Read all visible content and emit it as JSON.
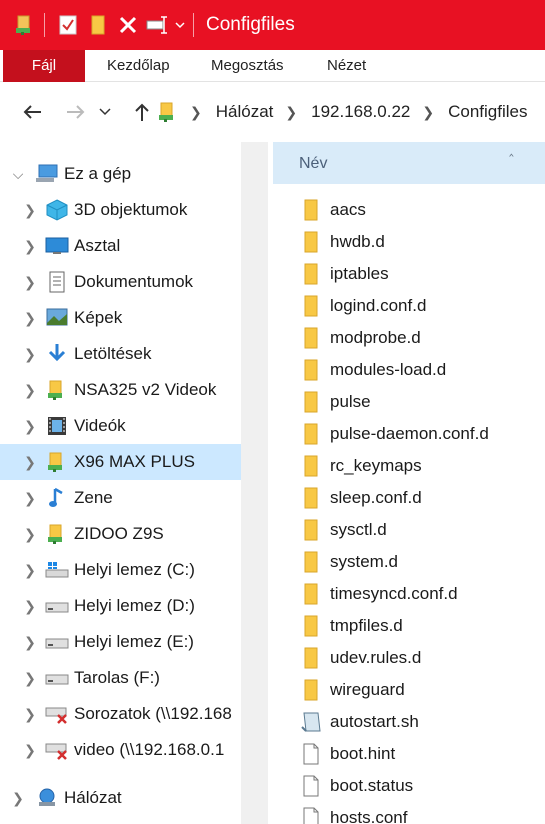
{
  "window": {
    "title": "Configfiles"
  },
  "ribbon": {
    "tabs": [
      "Fájl",
      "Kezdőlap",
      "Megosztás",
      "Nézet"
    ]
  },
  "address": {
    "crumbs": [
      "Hálózat",
      "192.168.0.22",
      "Configfiles"
    ]
  },
  "nav": {
    "this_pc": "Ez a gép",
    "items": [
      {
        "label": "3D objektumok",
        "icon": "3d-objects-icon"
      },
      {
        "label": "Asztal",
        "icon": "desktop-icon"
      },
      {
        "label": "Dokumentumok",
        "icon": "documents-icon"
      },
      {
        "label": "Képek",
        "icon": "pictures-icon"
      },
      {
        "label": "Letöltések",
        "icon": "downloads-icon"
      },
      {
        "label": "NSA325 v2 Videok",
        "icon": "network-folder-icon"
      },
      {
        "label": "Videók",
        "icon": "videos-icon"
      },
      {
        "label": "X96 MAX PLUS",
        "icon": "network-folder-icon"
      },
      {
        "label": "Zene",
        "icon": "music-icon"
      },
      {
        "label": "ZIDOO Z9S",
        "icon": "network-folder-icon"
      },
      {
        "label": "Helyi lemez (C:)",
        "icon": "windows-drive-icon"
      },
      {
        "label": "Helyi lemez (D:)",
        "icon": "drive-icon"
      },
      {
        "label": "Helyi lemez (E:)",
        "icon": "drive-icon"
      },
      {
        "label": "Tarolas (F:)",
        "icon": "drive-icon"
      },
      {
        "label": "Sorozatok (\\\\192.168",
        "icon": "disconnected-drive-icon"
      },
      {
        "label": "video (\\\\192.168.0.1",
        "icon": "disconnected-drive-icon"
      }
    ],
    "network": "Hálózat",
    "selected": "X96 MAX PLUS"
  },
  "list": {
    "column_name": "Név",
    "files": [
      {
        "name": "aacs",
        "type": "folder"
      },
      {
        "name": "hwdb.d",
        "type": "folder"
      },
      {
        "name": "iptables",
        "type": "folder"
      },
      {
        "name": "logind.conf.d",
        "type": "folder"
      },
      {
        "name": "modprobe.d",
        "type": "folder"
      },
      {
        "name": "modules-load.d",
        "type": "folder"
      },
      {
        "name": "pulse",
        "type": "folder"
      },
      {
        "name": "pulse-daemon.conf.d",
        "type": "folder"
      },
      {
        "name": "rc_keymaps",
        "type": "folder"
      },
      {
        "name": "sleep.conf.d",
        "type": "folder"
      },
      {
        "name": "sysctl.d",
        "type": "folder"
      },
      {
        "name": "system.d",
        "type": "folder"
      },
      {
        "name": "timesyncd.conf.d",
        "type": "folder"
      },
      {
        "name": "tmpfiles.d",
        "type": "folder"
      },
      {
        "name": "udev.rules.d",
        "type": "folder"
      },
      {
        "name": "wireguard",
        "type": "folder"
      },
      {
        "name": "autostart.sh",
        "type": "script"
      },
      {
        "name": "boot.hint",
        "type": "file"
      },
      {
        "name": "boot.status",
        "type": "file"
      },
      {
        "name": "hosts.conf",
        "type": "file"
      }
    ]
  },
  "colors": {
    "titlebar": "#e81123",
    "file_tab": "#c4101d",
    "selected": "#cce8ff",
    "header": "#d9ebf9",
    "folder": "#f8c845"
  }
}
